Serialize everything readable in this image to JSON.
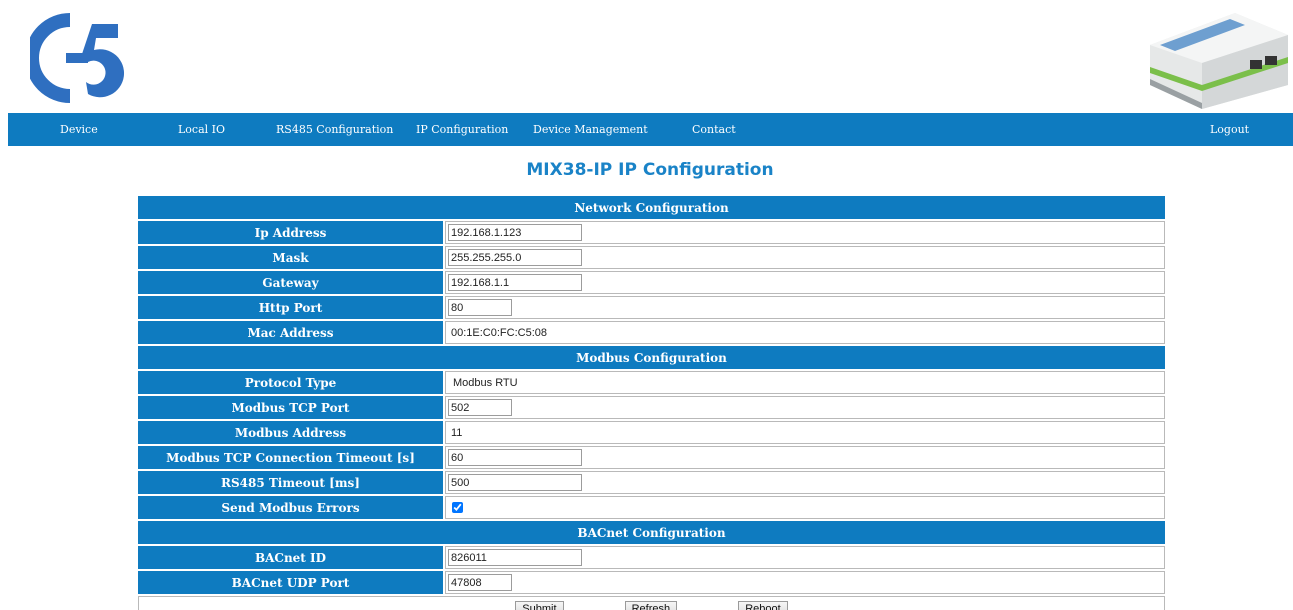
{
  "nav": {
    "device": "Device",
    "local_io": "Local IO",
    "rs485": "RS485 Configuration",
    "ip": "IP Configuration",
    "device_mgmt": "Device Management",
    "contact": "Contact",
    "logout": "Logout"
  },
  "page_title": "MIX38-IP IP Configuration",
  "network": {
    "header": "Network Configuration",
    "ip_label": "Ip Address",
    "ip_value": "192.168.1.123",
    "mask_label": "Mask",
    "mask_value": "255.255.255.0",
    "gateway_label": "Gateway",
    "gateway_value": "192.168.1.1",
    "http_label": "Http Port",
    "http_value": "80",
    "mac_label": "Mac Address",
    "mac_value": "00:1E:C0:FC:C5:08"
  },
  "modbus": {
    "header": "Modbus Configuration",
    "protocol_label": "Protocol Type",
    "protocol_value": "Modbus RTU",
    "tcp_port_label": "Modbus TCP Port",
    "tcp_port_value": "502",
    "address_label": "Modbus Address",
    "address_value": "11",
    "conn_timeout_label": "Modbus TCP Connection Timeout [s]",
    "conn_timeout_value": "60",
    "rs485_timeout_label": "RS485 Timeout [ms]",
    "rs485_timeout_value": "500",
    "send_errors_label": "Send Modbus Errors",
    "send_errors_checked": true
  },
  "bacnet": {
    "header": "BACnet Configuration",
    "id_label": "BACnet ID",
    "id_value": "826011",
    "udp_label": "BACnet UDP Port",
    "udp_value": "47808"
  },
  "buttons": {
    "submit": "Submit",
    "refresh": "Refresh",
    "reboot": "Reboot"
  },
  "colors": {
    "brand_blue": "#0e7bc0",
    "title_blue": "#1a83c7",
    "logo_blue": "#2f6fc0"
  },
  "icons": {
    "logo": "g5-logo-icon",
    "device": "din-rail-device-icon"
  }
}
